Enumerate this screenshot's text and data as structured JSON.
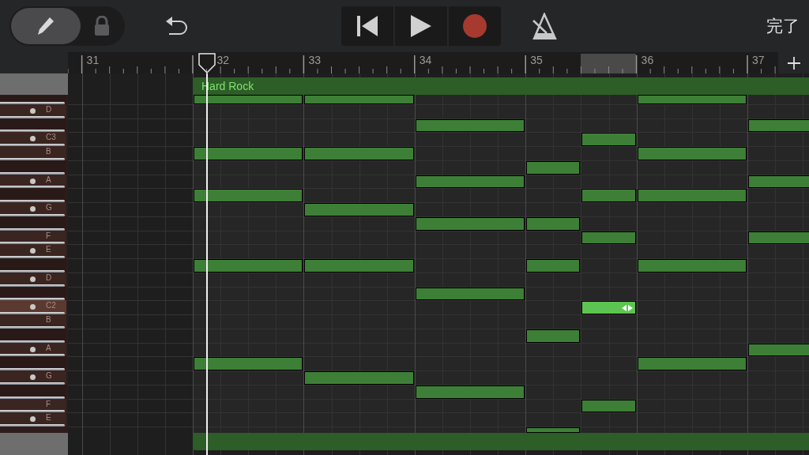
{
  "toolbar": {
    "tools": [
      {
        "kind": "pencil",
        "selected": true
      },
      {
        "kind": "lock",
        "selected": false
      }
    ],
    "transport": [
      {
        "kind": "rewind"
      },
      {
        "kind": "play"
      },
      {
        "kind": "record"
      }
    ],
    "done": "完了"
  },
  "ruler": {
    "bars": [
      "31",
      "32",
      "33",
      "34",
      "35",
      "36",
      "37"
    ]
  },
  "region": {
    "name": "Hard Rock"
  },
  "keys": [
    {
      "kind": "black",
      "dot": false,
      "selected": false
    },
    {
      "kind": "white",
      "label": "D",
      "dot": true,
      "selected": false
    },
    {
      "kind": "black",
      "dot": false,
      "selected": false
    },
    {
      "kind": "white",
      "label": "C3",
      "dot": true,
      "selected": false
    },
    {
      "kind": "white",
      "label": "B",
      "dot": false,
      "selected": false
    },
    {
      "kind": "black",
      "dot": false,
      "selected": false
    },
    {
      "kind": "white",
      "label": "A",
      "dot": true,
      "selected": false
    },
    {
      "kind": "black",
      "dot": false,
      "selected": false
    },
    {
      "kind": "white",
      "label": "G",
      "dot": true,
      "selected": false
    },
    {
      "kind": "black",
      "dot": false,
      "selected": false
    },
    {
      "kind": "white",
      "label": "F",
      "dot": false,
      "selected": false
    },
    {
      "kind": "white",
      "label": "E",
      "dot": true,
      "selected": false
    },
    {
      "kind": "black",
      "dot": false,
      "selected": false
    },
    {
      "kind": "white",
      "label": "D",
      "dot": true,
      "selected": false
    },
    {
      "kind": "black",
      "dot": false,
      "selected": false
    },
    {
      "kind": "white",
      "label": "C2",
      "dot": true,
      "selected": true
    },
    {
      "kind": "white",
      "label": "B",
      "dot": false,
      "selected": false
    },
    {
      "kind": "black",
      "dot": false,
      "selected": false
    },
    {
      "kind": "white",
      "label": "A",
      "dot": true,
      "selected": false
    },
    {
      "kind": "black",
      "dot": false,
      "selected": false
    },
    {
      "kind": "white",
      "label": "G",
      "dot": true,
      "selected": false
    },
    {
      "kind": "black",
      "dot": false,
      "selected": false
    },
    {
      "kind": "white",
      "label": "F",
      "dot": false,
      "selected": false
    },
    {
      "kind": "white",
      "label": "E",
      "dot": true,
      "selected": false
    }
  ],
  "notes": [
    {
      "selected": false
    },
    {
      "selected": false
    },
    {
      "selected": false
    },
    {
      "selected": false
    },
    {
      "selected": false
    },
    {
      "selected": false
    },
    {
      "selected": false
    },
    {
      "selected": false
    },
    {
      "selected": false
    },
    {
      "selected": false
    },
    {
      "selected": false
    },
    {
      "selected": false
    },
    {
      "selected": false
    },
    {
      "selected": false
    },
    {
      "selected": false
    },
    {
      "selected": false
    },
    {
      "selected": false
    },
    {
      "selected": false
    },
    {
      "selected": false
    },
    {
      "selected": false
    },
    {
      "selected": false
    },
    {
      "selected": false
    },
    {
      "selected": false
    },
    {
      "selected": false
    },
    {
      "selected": false
    },
    {
      "selected": true
    },
    {
      "selected": false
    },
    {
      "selected": false
    },
    {
      "selected": false
    },
    {
      "selected": false
    },
    {
      "selected": false
    },
    {
      "selected": false
    },
    {
      "selected": false
    },
    {
      "selected": false
    }
  ]
}
